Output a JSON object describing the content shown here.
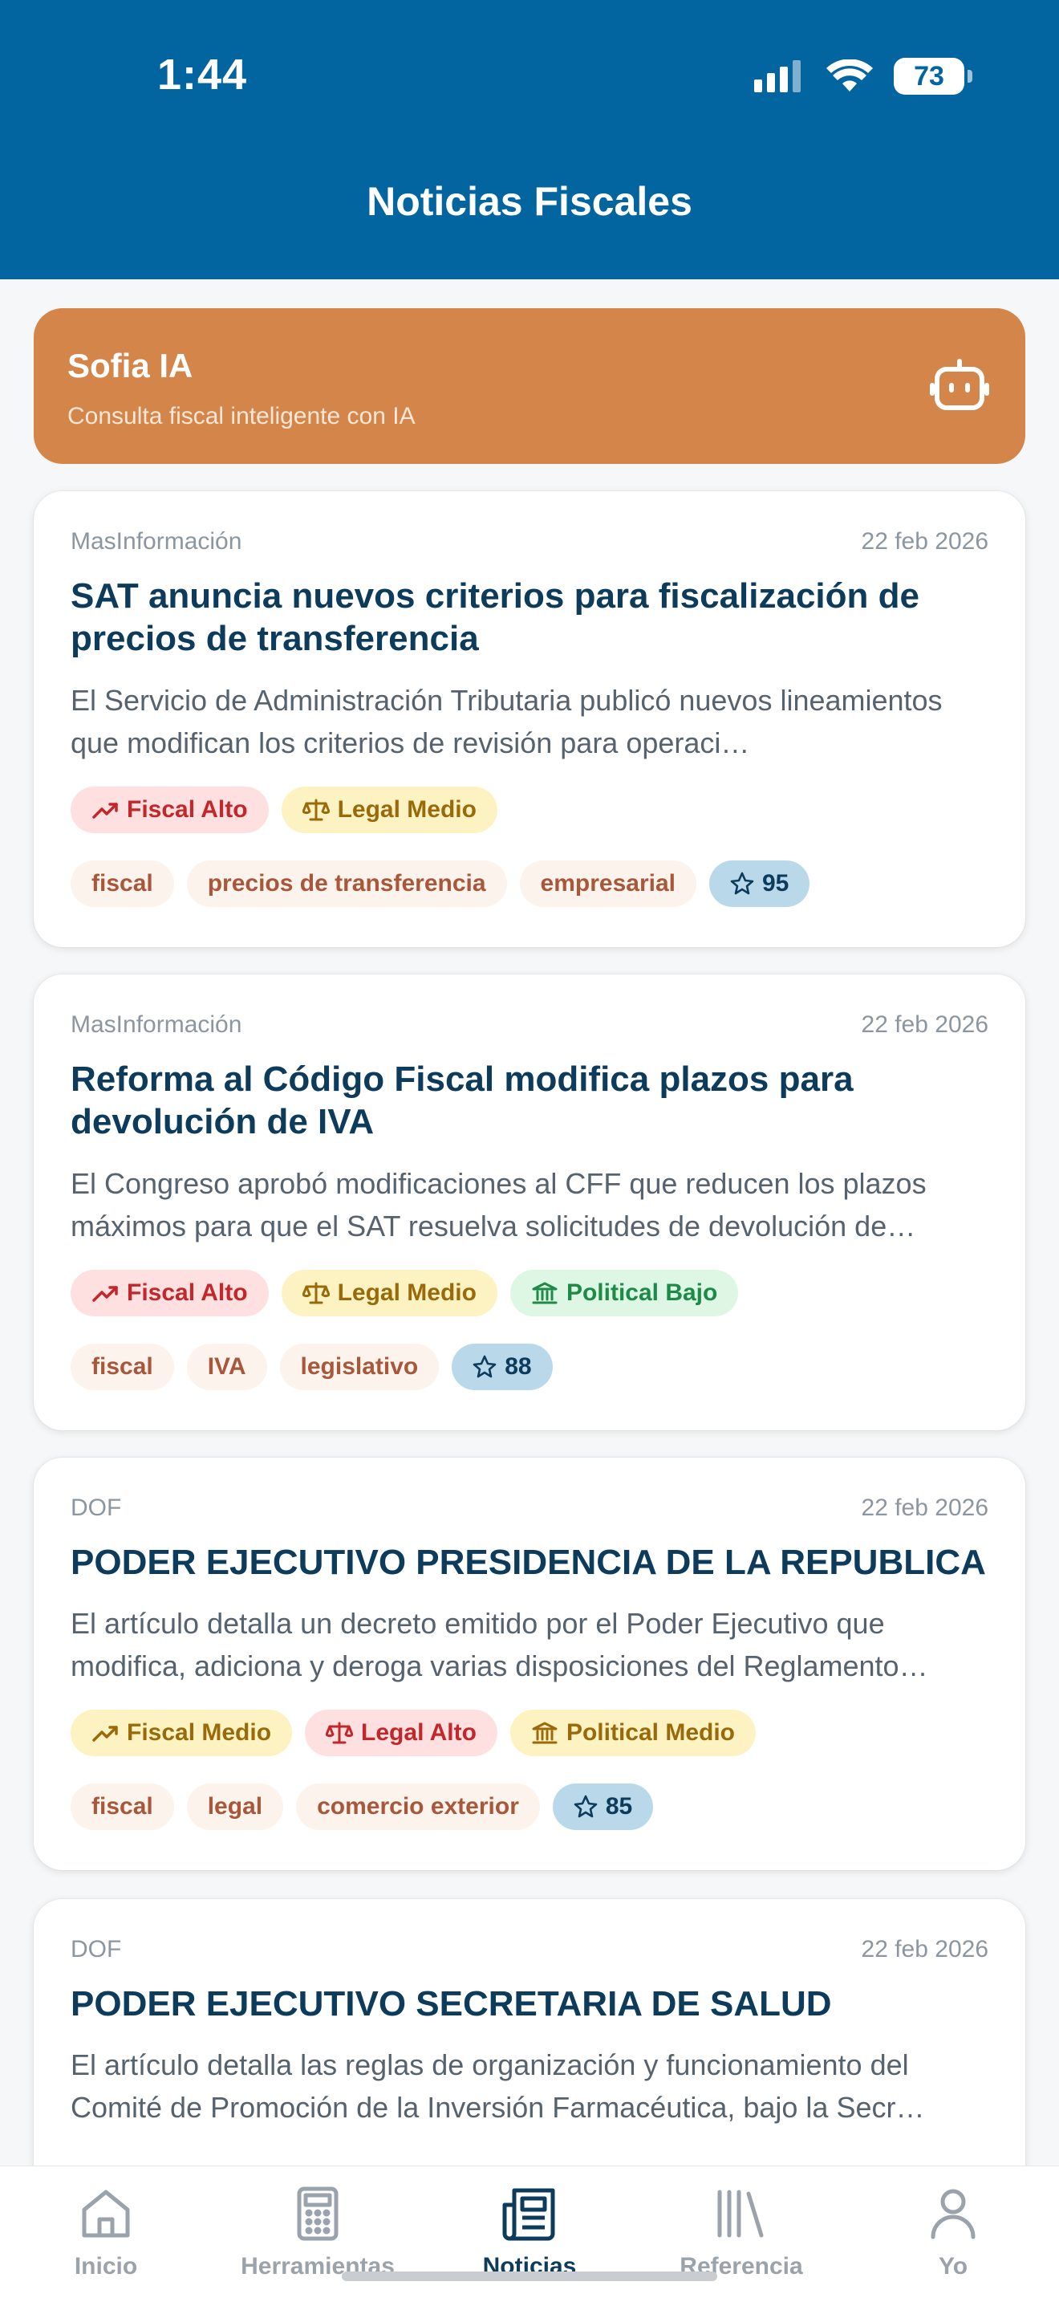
{
  "status": {
    "time": "1:44",
    "battery": "73"
  },
  "header": {
    "title": "Noticias Fiscales"
  },
  "ai_card": {
    "title": "Sofia IA",
    "subtitle": "Consulta fiscal inteligente con IA"
  },
  "news": [
    {
      "source": "MasInformación",
      "date": "22 feb 2026",
      "title": "SAT anuncia nuevos criterios para fiscalización de precios de transferencia",
      "summary": "El Servicio de Administración Tributaria publicó nuevos lineamientos que modifican los criterios de revisión para operaci…",
      "impacts": [
        {
          "label": "Fiscal Alto",
          "icon": "trend-up-icon",
          "level": "alto"
        },
        {
          "label": "Legal Medio",
          "icon": "scale-icon",
          "level": "medio"
        }
      ],
      "tags": [
        "fiscal",
        "precios de transferencia",
        "empresarial"
      ],
      "score": "95"
    },
    {
      "source": "MasInformación",
      "date": "22 feb 2026",
      "title": "Reforma al Código Fiscal modifica plazos para devolución de IVA",
      "summary": "El Congreso aprobó modificaciones al CFF que reducen los plazos máximos para que el SAT resuelva solicitudes de devolución de…",
      "impacts": [
        {
          "label": "Fiscal Alto",
          "icon": "trend-up-icon",
          "level": "alto"
        },
        {
          "label": "Legal Medio",
          "icon": "scale-icon",
          "level": "medio"
        },
        {
          "label": "Political Bajo",
          "icon": "bank-icon",
          "level": "bajo"
        }
      ],
      "tags": [
        "fiscal",
        "IVA",
        "legislativo"
      ],
      "score": "88"
    },
    {
      "source": "DOF",
      "date": "22 feb 2026",
      "title": "PODER EJECUTIVO PRESIDENCIA DE LA REPUBLICA",
      "summary": "El artículo detalla un decreto emitido por el Poder Ejecutivo que modifica, adiciona y deroga varias disposiciones del Reglamento…",
      "impacts": [
        {
          "label": "Fiscal Medio",
          "icon": "trend-up-icon",
          "level": "medio"
        },
        {
          "label": "Legal Alto",
          "icon": "scale-icon",
          "level": "alto"
        },
        {
          "label": "Political Medio",
          "icon": "bank-icon",
          "level": "medio"
        }
      ],
      "tags": [
        "fiscal",
        "legal",
        "comercio exterior"
      ],
      "score": "85"
    },
    {
      "source": "DOF",
      "date": "22 feb 2026",
      "title": "PODER EJECUTIVO SECRETARIA DE SALUD",
      "summary": "El artículo detalla las reglas de organización y funcionamiento del Comité de Promoción de la Inversión Farmacéutica, bajo la Secr…"
    }
  ],
  "tabs": [
    {
      "label": "Inicio",
      "icon": "home-icon"
    },
    {
      "label": "Herramientas",
      "icon": "calculator-icon"
    },
    {
      "label": "Noticias",
      "icon": "newspaper-icon",
      "active": true
    },
    {
      "label": "Referencia",
      "icon": "library-icon"
    },
    {
      "label": "Yo",
      "icon": "person-icon"
    }
  ],
  "colors": {
    "header": "#03659f",
    "ai_card": "#d4854a",
    "title": "#0d3b5c",
    "alto": "#c3262b",
    "medio": "#9a6a0a",
    "bajo": "#1d8a48"
  }
}
